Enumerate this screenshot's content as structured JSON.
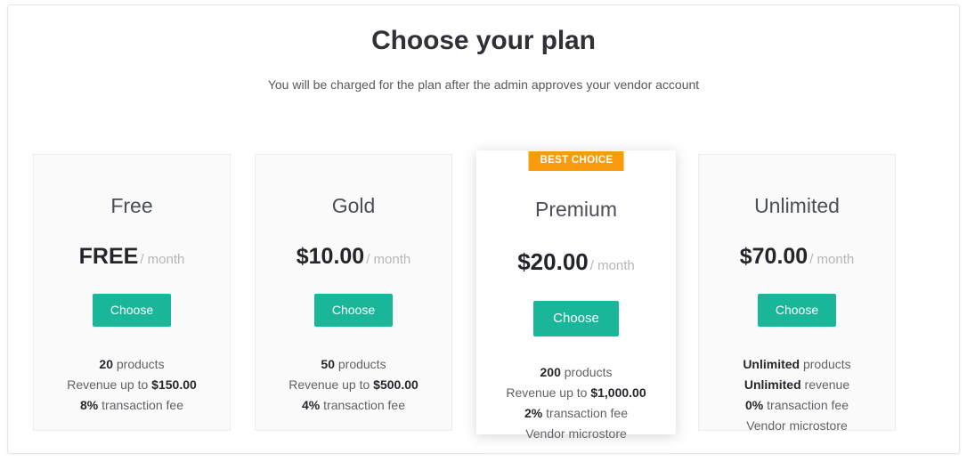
{
  "header": {
    "title": "Choose your plan",
    "subtitle": "You will be charged for the plan after the admin approves your vendor account"
  },
  "colors": {
    "accent_button": "#1ab69a",
    "badge": "#f99b0c",
    "card_background": "#fafafa",
    "featured_card_background": "#ffffff",
    "card_border": "#ededed",
    "title_text": "#2e3138",
    "muted_text": "#b4b6ba"
  },
  "plans": [
    {
      "name": "Free",
      "amount": "FREE",
      "period": "/ month",
      "button_label": "Choose",
      "badge": "",
      "featured": false,
      "features": [
        {
          "value": "20",
          "label": " products",
          "value_first": true
        },
        {
          "value": "$150.00",
          "label": "Revenue up to ",
          "value_first": false
        },
        {
          "value": "8%",
          "label": " transaction fee",
          "value_first": true
        },
        {
          "value": "",
          "label": "",
          "value_first": true
        }
      ]
    },
    {
      "name": "Gold",
      "amount": "$10.00",
      "period": "/ month",
      "button_label": "Choose",
      "badge": "",
      "featured": false,
      "features": [
        {
          "value": "50",
          "label": " products",
          "value_first": true
        },
        {
          "value": "$500.00",
          "label": "Revenue up to ",
          "value_first": false
        },
        {
          "value": "4%",
          "label": " transaction fee",
          "value_first": true
        },
        {
          "value": "",
          "label": "",
          "value_first": true
        }
      ]
    },
    {
      "name": "Premium",
      "amount": "$20.00",
      "period": "/ month",
      "button_label": "Choose",
      "badge": "BEST CHOICE",
      "featured": true,
      "features": [
        {
          "value": "200",
          "label": " products",
          "value_first": true
        },
        {
          "value": "$1,000.00",
          "label": "Revenue up to ",
          "value_first": false
        },
        {
          "value": "2%",
          "label": " transaction fee",
          "value_first": true
        },
        {
          "value": "",
          "label": "Vendor microstore",
          "value_first": true
        }
      ]
    },
    {
      "name": "Unlimited",
      "amount": "$70.00",
      "period": "/ month",
      "button_label": "Choose",
      "badge": "",
      "featured": false,
      "features": [
        {
          "value": "Unlimited",
          "label": " products",
          "value_first": true
        },
        {
          "value": "Unlimited",
          "label": " revenue",
          "value_first": true
        },
        {
          "value": "0%",
          "label": " transaction fee",
          "value_first": true
        },
        {
          "value": "",
          "label": "Vendor microstore",
          "value_first": true
        }
      ]
    }
  ]
}
